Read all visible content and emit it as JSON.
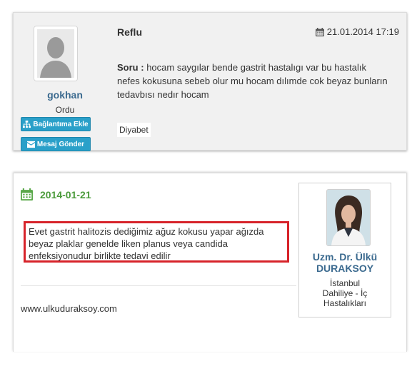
{
  "question": {
    "user": {
      "name": "gokhan",
      "city": "Ordu",
      "avatar_icon": "user-silhouette-icon"
    },
    "buttons": {
      "connect_label": "Bağlantıma Ekle",
      "message_label": "Mesaj Gönder"
    },
    "title": "Reflu",
    "date": "21.01.2014 17:19",
    "label": "Soru :",
    "text": "hocam saygılar bende gastrit hastalıgı var bu hastalık nefes kokusuna sebeb olur mu hocam dılımde cok beyaz bunların tedavbısı nedır hocam",
    "tag": "Diyabet"
  },
  "answer": {
    "date": "2014-01-21",
    "text": "Evet gastrit halitozis dediğimiz ağuz kokusu yapar ağızda beyaz plaklar genelde liken planus veya candida enfeksiyonudur birlikte tedavi edilir",
    "website": "www.ulkuduraksoy.com",
    "doctor": {
      "name_line1": "Uzm. Dr. Ülkü",
      "name_line2": "DURAKSOY",
      "city": "İstanbul",
      "specialty_line1": "Dahiliye - İç",
      "specialty_line2": "Hastalıkları"
    }
  },
  "colors": {
    "accent_button": "#2aa0c9",
    "link_blue": "#3b6a8f",
    "date_green": "#4a9a3a",
    "highlight_red": "#d7232a"
  }
}
